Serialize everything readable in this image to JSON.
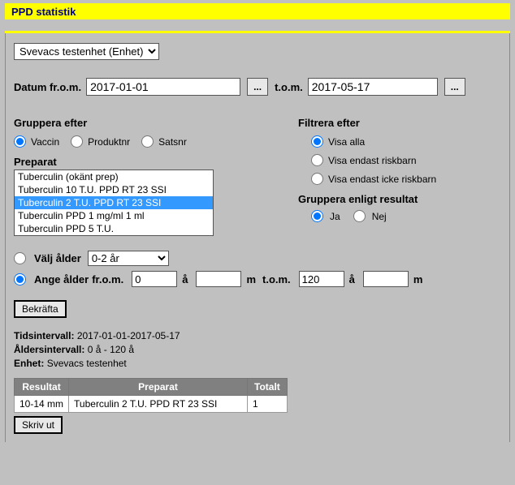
{
  "title": "PPD statistik",
  "unit_selected": "Svevacs testenhet (Enhet)",
  "date": {
    "from_label": "Datum fr.o.m.",
    "from_value": "2017-01-01",
    "to_label": "t.o.m.",
    "to_value": "2017-05-17",
    "picker_btn": "..."
  },
  "group_by": {
    "heading": "Gruppera efter",
    "items": [
      "Vaccin",
      "Produktnr",
      "Satsnr"
    ]
  },
  "preparat": {
    "heading": "Preparat",
    "options": [
      "Tuberculin (okänt prep)",
      "Tuberculin 10 T.U. PPD RT 23 SSI",
      "Tuberculin 2 T.U. PPD RT 23 SSI",
      "Tuberculin PPD 1 mg/ml 1 ml",
      "Tuberculin PPD 5 T.U."
    ],
    "selected_index": 2
  },
  "filter": {
    "heading": "Filtrera efter",
    "options": [
      "Visa alla",
      "Visa endast riskbarn",
      "Visa endast icke riskbarn"
    ]
  },
  "group_result": {
    "heading": "Gruppera enligt resultat",
    "yes": "Ja",
    "no": "Nej"
  },
  "age": {
    "choose_label": "Välj ålder",
    "range_label": "Ange ålder",
    "range_selected": "0-2 år",
    "from_label": "fr.o.m.",
    "from_value": "0",
    "year_unit": "å",
    "month_unit": "m",
    "to_label": "t.o.m.",
    "to_value": "120"
  },
  "confirm_btn": "Bekräfta",
  "summary": {
    "tids_label": "Tidsintervall:",
    "tids_value": "2017-01-01-2017-05-17",
    "alder_label": "Åldersintervall:",
    "alder_value": "0 å - 120 å",
    "enhet_label": "Enhet:",
    "enhet_value": "Svevacs testenhet"
  },
  "table": {
    "headers": [
      "Resultat",
      "Preparat",
      "Totalt"
    ],
    "rows": [
      [
        "10-14 mm",
        "Tuberculin 2 T.U. PPD RT 23 SSI",
        "1"
      ]
    ]
  },
  "print_btn": "Skriv ut"
}
